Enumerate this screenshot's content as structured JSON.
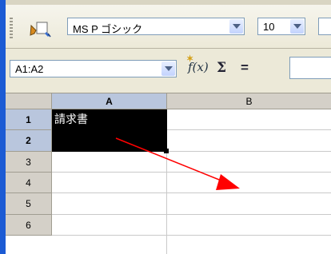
{
  "font_name": {
    "value": "MS P ゴシック"
  },
  "font_size": {
    "value": "10"
  },
  "name_box": {
    "value": "A1:A2"
  },
  "formula_bar": {
    "fx_label": "f(x)",
    "sigma_label": "Σ",
    "equals_label": "="
  },
  "columns": [
    "A",
    "B"
  ],
  "rows": [
    "1",
    "2",
    "3",
    "4",
    "5",
    "6"
  ],
  "cells": {
    "A1": "請求書",
    "A2": ""
  },
  "colors": {
    "selection": "#000000",
    "annotation_arrow": "#ff0000",
    "header_bg": "#d4d0c8",
    "selected_header_bg": "#b9c6dd"
  }
}
